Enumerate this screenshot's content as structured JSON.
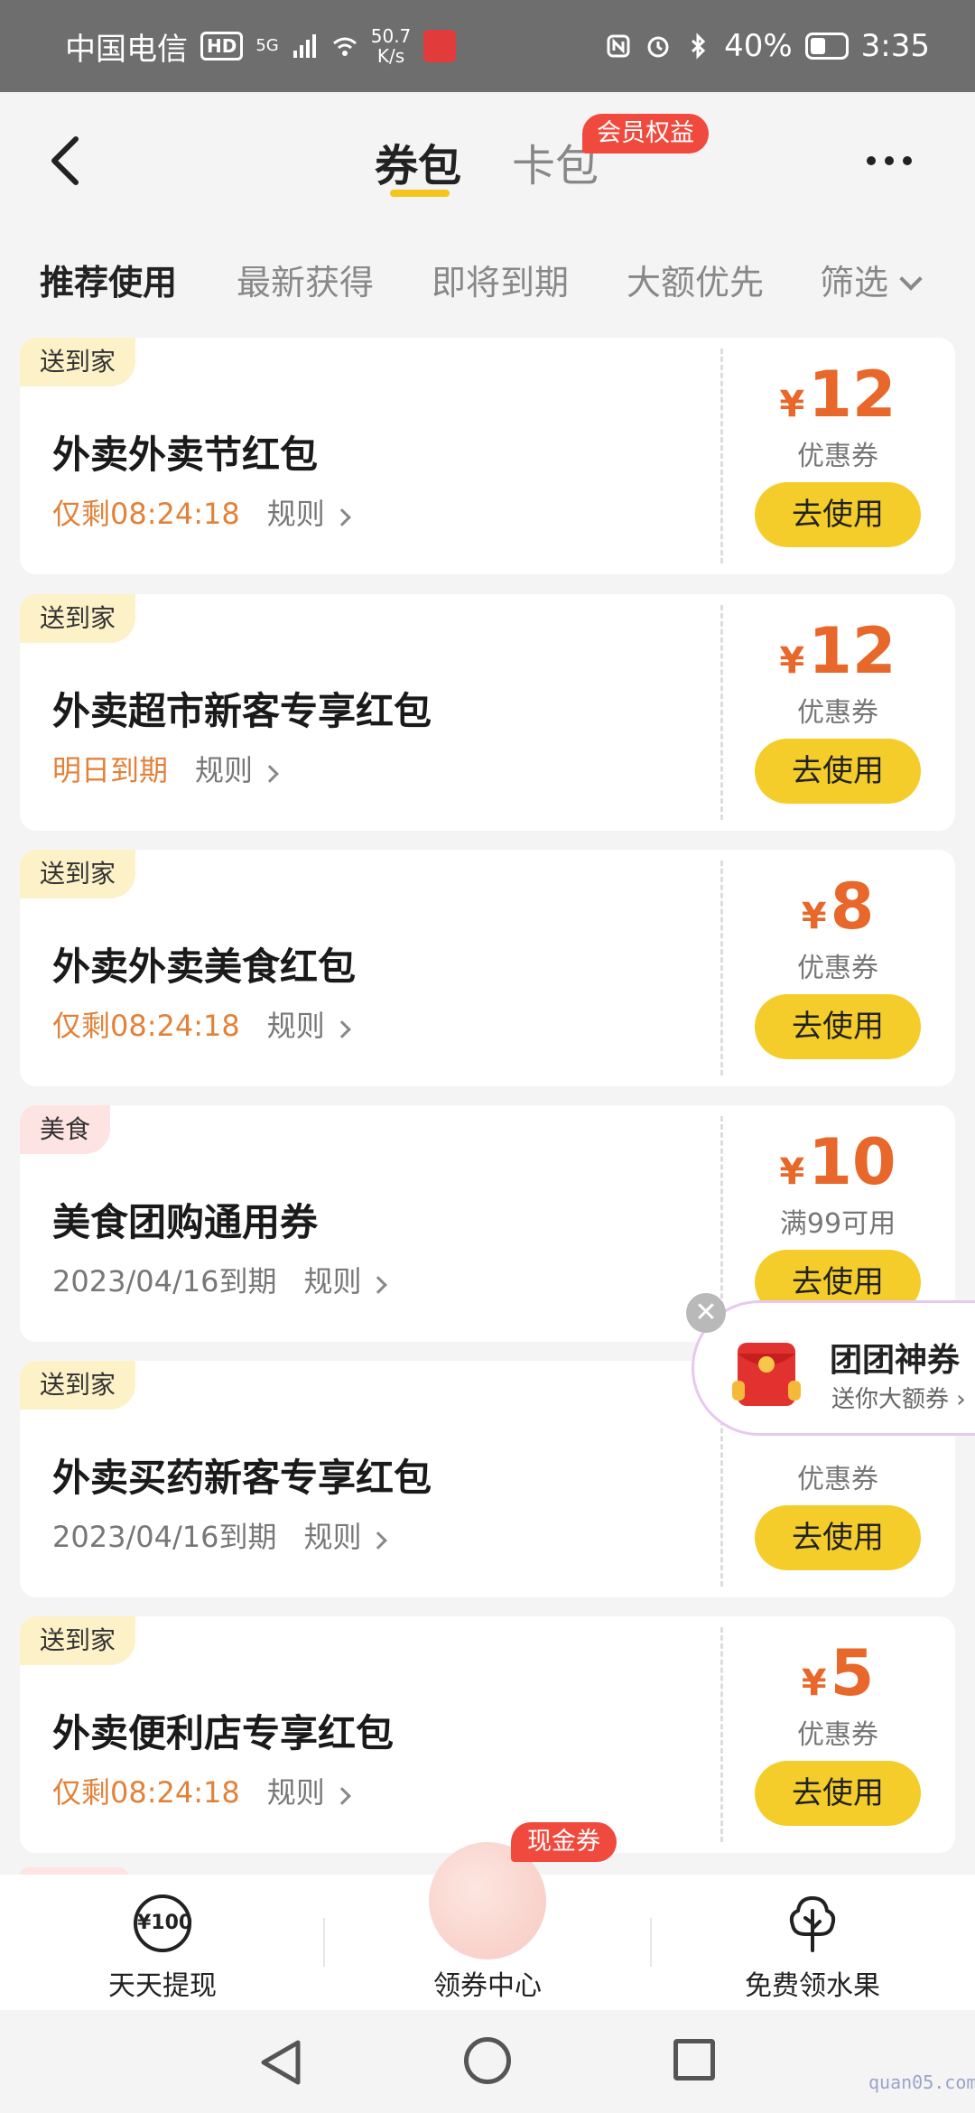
{
  "status_bar": {
    "carrier": "中国电信",
    "hd": "HD",
    "network": "5G",
    "speed_value": "50.7",
    "speed_unit": "K/s",
    "battery": "40%",
    "time": "3:35"
  },
  "header": {
    "tab_active": "券包",
    "tab_inactive": "卡包",
    "member_badge": "会员权益"
  },
  "filters": [
    "推荐使用",
    "最新获得",
    "即将到期",
    "大额优先",
    "筛选"
  ],
  "coupons": [
    {
      "tag": "送到家",
      "tag_type": "delivery",
      "title": "外卖外卖节红包",
      "expiry": "仅剩08:24:18",
      "expiry_style": "urgent",
      "rule": "规则",
      "currency": "¥",
      "amount": "12",
      "kind": "优惠券",
      "button": "去使用"
    },
    {
      "tag": "送到家",
      "tag_type": "delivery",
      "title": "外卖超市新客专享红包",
      "expiry": "明日到期",
      "expiry_style": "urgent",
      "rule": "规则",
      "currency": "¥",
      "amount": "12",
      "kind": "优惠券",
      "button": "去使用"
    },
    {
      "tag": "送到家",
      "tag_type": "delivery",
      "title": "外卖外卖美食红包",
      "expiry": "仅剩08:24:18",
      "expiry_style": "urgent",
      "rule": "规则",
      "currency": "¥",
      "amount": "8",
      "kind": "优惠券",
      "button": "去使用"
    },
    {
      "tag": "美食",
      "tag_type": "food",
      "title": "美食团购通用券",
      "expiry": "2023/04/16到期",
      "expiry_style": "plain",
      "rule": "规则",
      "currency": "¥",
      "amount": "10",
      "kind": "满99可用",
      "button": "去使用"
    },
    {
      "tag": "送到家",
      "tag_type": "delivery",
      "title": "外卖买药新客专享红包",
      "expiry": "2023/04/16到期",
      "expiry_style": "plain",
      "rule": "规则",
      "currency": "",
      "amount": "",
      "kind": "优惠券",
      "button": "去使用"
    },
    {
      "tag": "送到家",
      "tag_type": "delivery",
      "title": "外卖便利店专享红包",
      "expiry": "仅剩08:24:18",
      "expiry_style": "urgent",
      "rule": "规则",
      "currency": "¥",
      "amount": "5",
      "kind": "优惠券",
      "button": "去使用"
    }
  ],
  "float_promo": {
    "title": "团团神券",
    "subtitle": "送你大额券 ›",
    "close": "✕"
  },
  "bottom_nav": {
    "left_icon_text": "¥100",
    "left_label": "天天提现",
    "center_badge": "现金券",
    "center_label": "领券中心",
    "right_label": "免费领水果"
  },
  "watermark": "quan05.com",
  "colors": {
    "accent_yellow": "#f5cd2a",
    "price_orange": "#e8672a",
    "badge_red": "#f04a3e"
  }
}
